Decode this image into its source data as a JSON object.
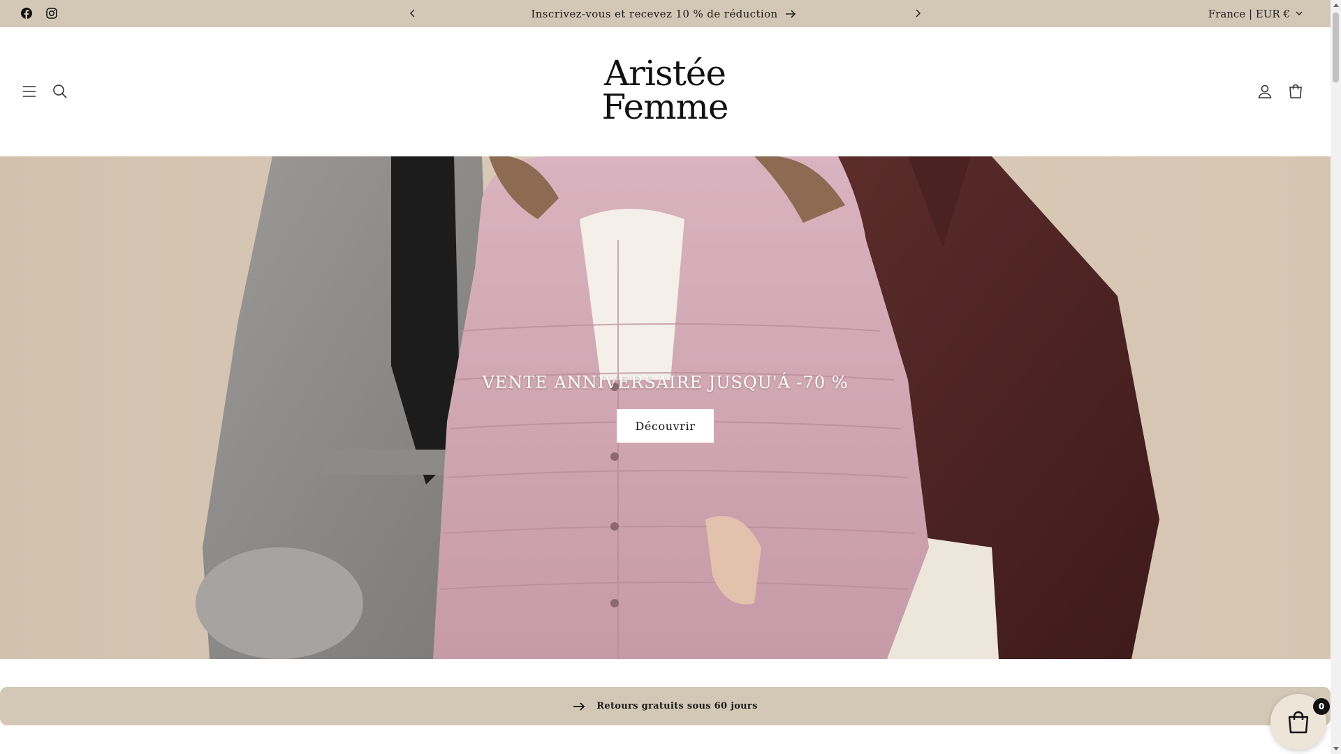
{
  "announcement": {
    "message": "Inscrivez-vous et recevez 10 % de réduction",
    "locale": "France | EUR €"
  },
  "icons": {
    "facebook": "facebook-icon",
    "instagram": "instagram-icon",
    "menu": "hamburger-menu-icon",
    "search": "search-icon",
    "account": "user-icon",
    "cart": "cart-icon"
  },
  "header": {
    "logo_line1": "Aristée",
    "logo_line2": "Femme"
  },
  "hero": {
    "title": "VENTE ANNIVERSAIRE JUSQU'Á -70 %",
    "button_label": "Découvrir"
  },
  "strip": {
    "text": "Retours gratuits sous 60 jours"
  },
  "floating_cart": {
    "count": "0"
  },
  "colors": {
    "announcement_bg": "#d3c8b6",
    "strip_bg": "#d3c8b6",
    "text": "#121212",
    "button_bg": "#ffffff"
  }
}
